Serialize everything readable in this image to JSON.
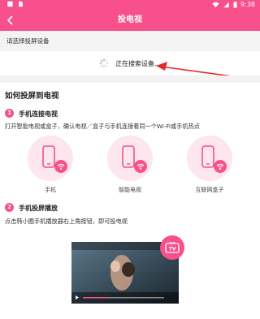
{
  "status_bar": {
    "time": "9:38",
    "icons": [
      "notification-icon",
      "sim-icon",
      "wifi-icon",
      "signal-icon",
      "battery-icon"
    ]
  },
  "app_bar": {
    "title": "投电视",
    "back_icon": "chevron-left-icon"
  },
  "device_select": {
    "label": "请选择投屏设备",
    "searching_text": "正在搜索设备..."
  },
  "guide": {
    "title": "如何投屏到电视",
    "steps": [
      {
        "number": "1",
        "title": "手机连接电视",
        "description": "打开智能电视或盒子，确认电视／盒子与手机连接着同一个Wi-Fi或手机热点"
      },
      {
        "number": "2",
        "title": "手机投屏播放",
        "description": "点击韩小圈手机播放器右上角按钮，即可投电视"
      }
    ],
    "devices": [
      {
        "label": "手机"
      },
      {
        "label": "智能电视"
      },
      {
        "label": "互联网盒子"
      }
    ],
    "tv_badge": "TV"
  },
  "colors": {
    "accent": "#f7508a",
    "light_accent": "#fde6ee",
    "arrow": "#e32b2b"
  }
}
